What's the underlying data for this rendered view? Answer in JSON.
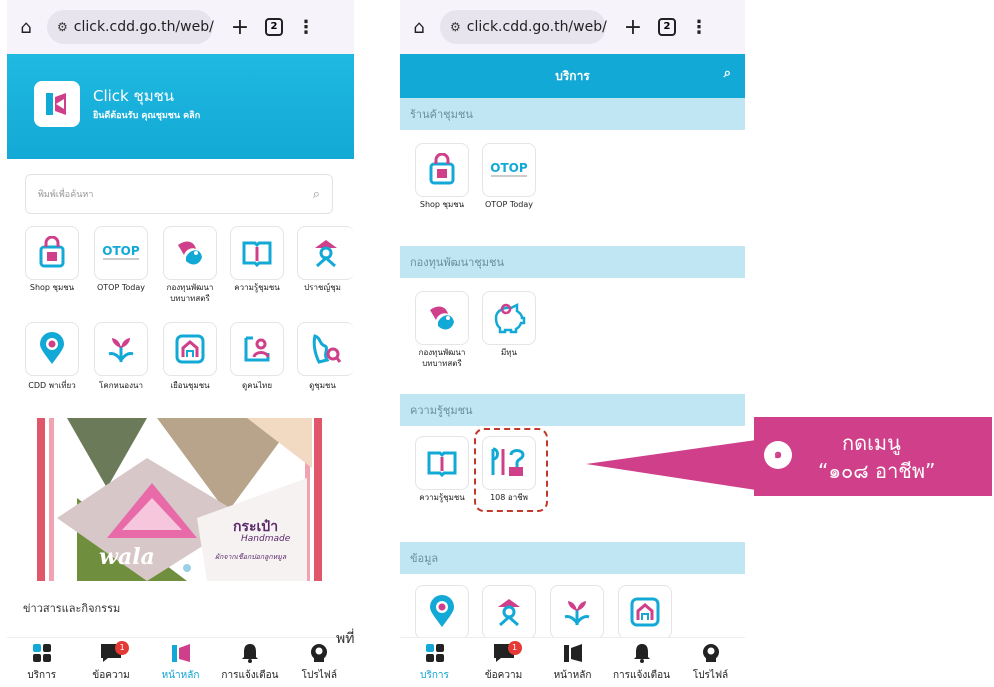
{
  "browser": {
    "url": "click.cdd.go.th/web/",
    "tab_count": "2"
  },
  "left": {
    "app_name": "Click ชุมชน",
    "welcome": "ยินดีต้อนรับ  คุณชุมชน คลิก",
    "search_placeholder": "พิมพ์เพื่อค้นหา",
    "menu": [
      "Shop ชุมชน",
      "OTOP Today",
      "กองทุนพัฒนา บทบาทสตรี",
      "ความรู้ชุมชน",
      "ปราชญ์ชุม",
      "CDD พาเที่ยว",
      "โคกหนองนา",
      "เยือนชุมชน",
      "ดูคนไทย",
      "ดูชุมชน"
    ],
    "banner_text1": "กระเป๋า",
    "banner_text2": "Handmade",
    "banner_text3": "ผักจากเชือกปอกลูกหมูล",
    "banner_brand": "wala",
    "news_title": "ข่าวสารและกิจกรรม"
  },
  "nav": {
    "items": [
      "บริการ",
      "ข้อความ",
      "หน้าหลัก",
      "การแจ้งเตือน",
      "โปรไฟล์"
    ],
    "badge": "1"
  },
  "right": {
    "header_title": "บริการ",
    "sections": [
      "ร้านค้าชุมชน",
      "กองทุนพัฒนาชุมชน",
      "ความรู้ชุมชน",
      "ข้อมูล"
    ],
    "shop_items": [
      "Shop ชุมชน",
      "OTOP Today"
    ],
    "fund_items": [
      "กองทุนพัฒนา บทบาทสตรี",
      "มีทุน"
    ],
    "know_items": [
      "ความรู้ชุมชน",
      "108 อาชีพ"
    ]
  },
  "callout": {
    "number": "๑",
    "line1": "กดเมนู",
    "line2": "“๑๐๘ อาชีพ”"
  },
  "stray_text": "พที่",
  "colors": {
    "primary": "#13a9d6",
    "pink": "#cf3f8a",
    "section": "#bfe6f2"
  }
}
